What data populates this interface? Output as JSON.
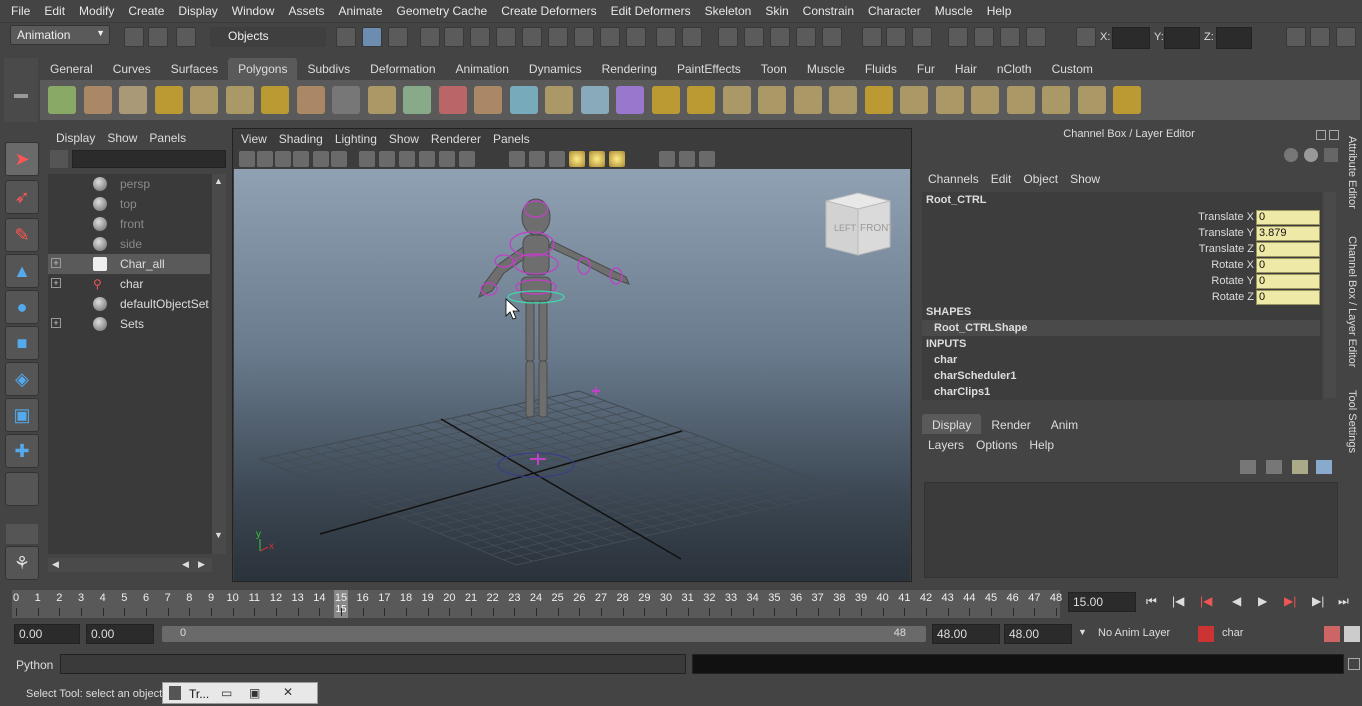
{
  "menubar": [
    "File",
    "Edit",
    "Modify",
    "Create",
    "Display",
    "Window",
    "Assets",
    "Animate",
    "Geometry Cache",
    "Create Deformers",
    "Edit Deformers",
    "Skeleton",
    "Skin",
    "Constrain",
    "Character",
    "Muscle",
    "Help"
  ],
  "statusline": {
    "menuset": "Animation",
    "selection_mode": "Objects",
    "coord_labels": [
      "X:",
      "Y:",
      "Z:"
    ]
  },
  "shelf": {
    "tabs": [
      "General",
      "Curves",
      "Surfaces",
      "Polygons",
      "Subdivs",
      "Deformation",
      "Animation",
      "Dynamics",
      "Rendering",
      "PaintEffects",
      "Toon",
      "Muscle",
      "Fluids",
      "Fur",
      "Hair",
      "nCloth",
      "Custom"
    ],
    "active_tab": "Polygons"
  },
  "outliner": {
    "menu": [
      "Display",
      "Show",
      "Panels"
    ],
    "items": [
      {
        "label": "persp",
        "dim": true,
        "icon": "camera-icon",
        "expandable": false
      },
      {
        "label": "top",
        "dim": true,
        "icon": "camera-icon",
        "expandable": false
      },
      {
        "label": "front",
        "dim": true,
        "icon": "camera-icon",
        "expandable": false
      },
      {
        "label": "side",
        "dim": true,
        "icon": "camera-icon",
        "expandable": false
      },
      {
        "label": "Char_all",
        "dim": false,
        "icon": "curve-icon",
        "expandable": true,
        "selected": true
      },
      {
        "label": "char",
        "dim": false,
        "icon": "character-icon",
        "expandable": true
      },
      {
        "label": "defaultObjectSet",
        "dim": false,
        "icon": "set-icon",
        "expandable": false
      },
      {
        "label": "Sets",
        "dim": false,
        "icon": "set-icon",
        "expandable": true
      }
    ]
  },
  "viewport": {
    "menu": [
      "View",
      "Shading",
      "Lighting",
      "Show",
      "Renderer",
      "Panels"
    ],
    "viewcube": {
      "left": "LEFT",
      "front": "FRONT"
    },
    "axis_labels": {
      "y": "y",
      "x": "x"
    }
  },
  "channelbox": {
    "title": "Channel Box / Layer Editor",
    "menu": [
      "Channels",
      "Edit",
      "Object",
      "Show"
    ],
    "object": "Root_CTRL",
    "channels": [
      {
        "name": "Translate X",
        "value": "0"
      },
      {
        "name": "Translate Y",
        "value": "3.879"
      },
      {
        "name": "Translate Z",
        "value": "0"
      },
      {
        "name": "Rotate X",
        "value": "0"
      },
      {
        "name": "Rotate Y",
        "value": "0"
      },
      {
        "name": "Rotate Z",
        "value": "0"
      }
    ],
    "shapes_header": "SHAPES",
    "shapes": [
      "Root_CTRLShape"
    ],
    "inputs_header": "INPUTS",
    "inputs": [
      "char",
      "charScheduler1",
      "charClips1"
    ]
  },
  "layer_editor": {
    "tabs": [
      "Display",
      "Render",
      "Anim"
    ],
    "active_tab": "Display",
    "menu": [
      "Layers",
      "Options",
      "Help"
    ]
  },
  "side_tabs": [
    "Attribute Editor",
    "Channel Box / Layer Editor",
    "Tool Settings"
  ],
  "timeslider": {
    "start": 0,
    "end": 48,
    "current": 15,
    "current_label": "15",
    "current_field": "15.00"
  },
  "rangeslider": {
    "start_time": "0.00",
    "playback_start": "0.00",
    "range_start_label": "0",
    "range_end_label": "48",
    "playback_end": "48.00",
    "end_time": "48.00",
    "anim_layer": "No Anim Layer",
    "character": "char"
  },
  "cmdline": {
    "label": "Python"
  },
  "helpline": {
    "text": "Select Tool: select an object",
    "minimized_window": "Tr..."
  }
}
